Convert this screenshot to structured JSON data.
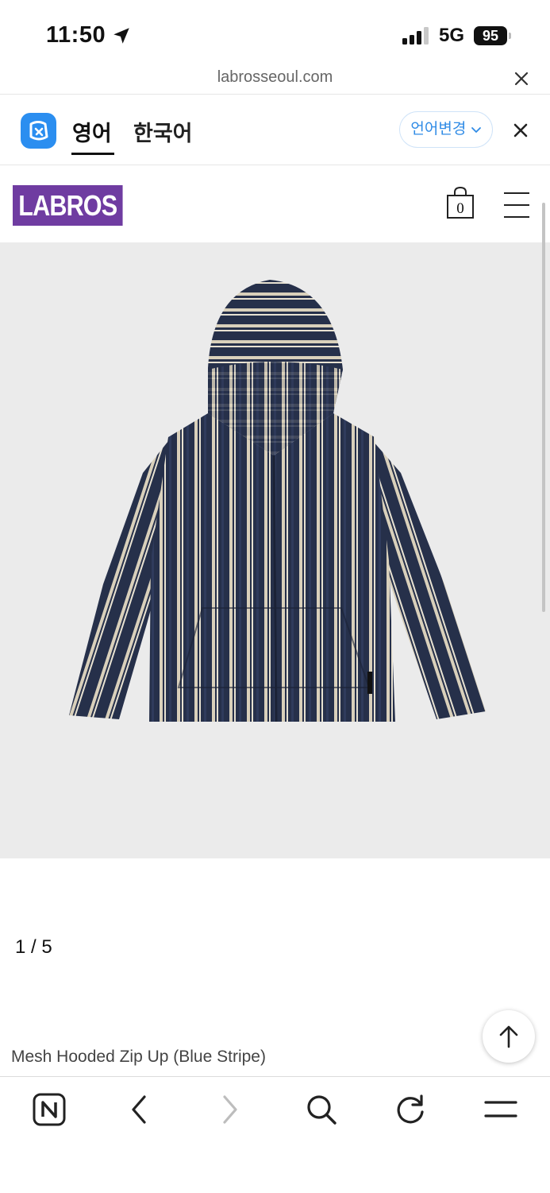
{
  "status_bar": {
    "time": "11:50",
    "network": "5G",
    "battery": "95"
  },
  "url_bar": {
    "url": "labrosseoul.com"
  },
  "translate_bar": {
    "tab_english": "영어",
    "tab_korean": "한국어",
    "change_language": "언어변경"
  },
  "site_header": {
    "logo": "LABROS",
    "cart_count": "0"
  },
  "product": {
    "image_counter": "1 / 5",
    "title": "Mesh Hooded Zip Up (Blue Stripe)"
  },
  "colors": {
    "brand": "#6f3ca1",
    "translate_accent": "#2f8be6",
    "image_background": "#ebebeb",
    "stripe_navy": "#26304a",
    "stripe_cream": "#d9d0bb"
  },
  "icons": [
    "location-arrow-icon",
    "signal-icon",
    "battery-icon",
    "close-icon",
    "papago-icon",
    "chevron-down-icon",
    "shopping-bag-icon",
    "hamburger-menu-icon",
    "arrow-up-icon",
    "naver-home-icon",
    "back-icon",
    "forward-icon",
    "search-icon",
    "reload-icon",
    "more-menu-icon"
  ]
}
